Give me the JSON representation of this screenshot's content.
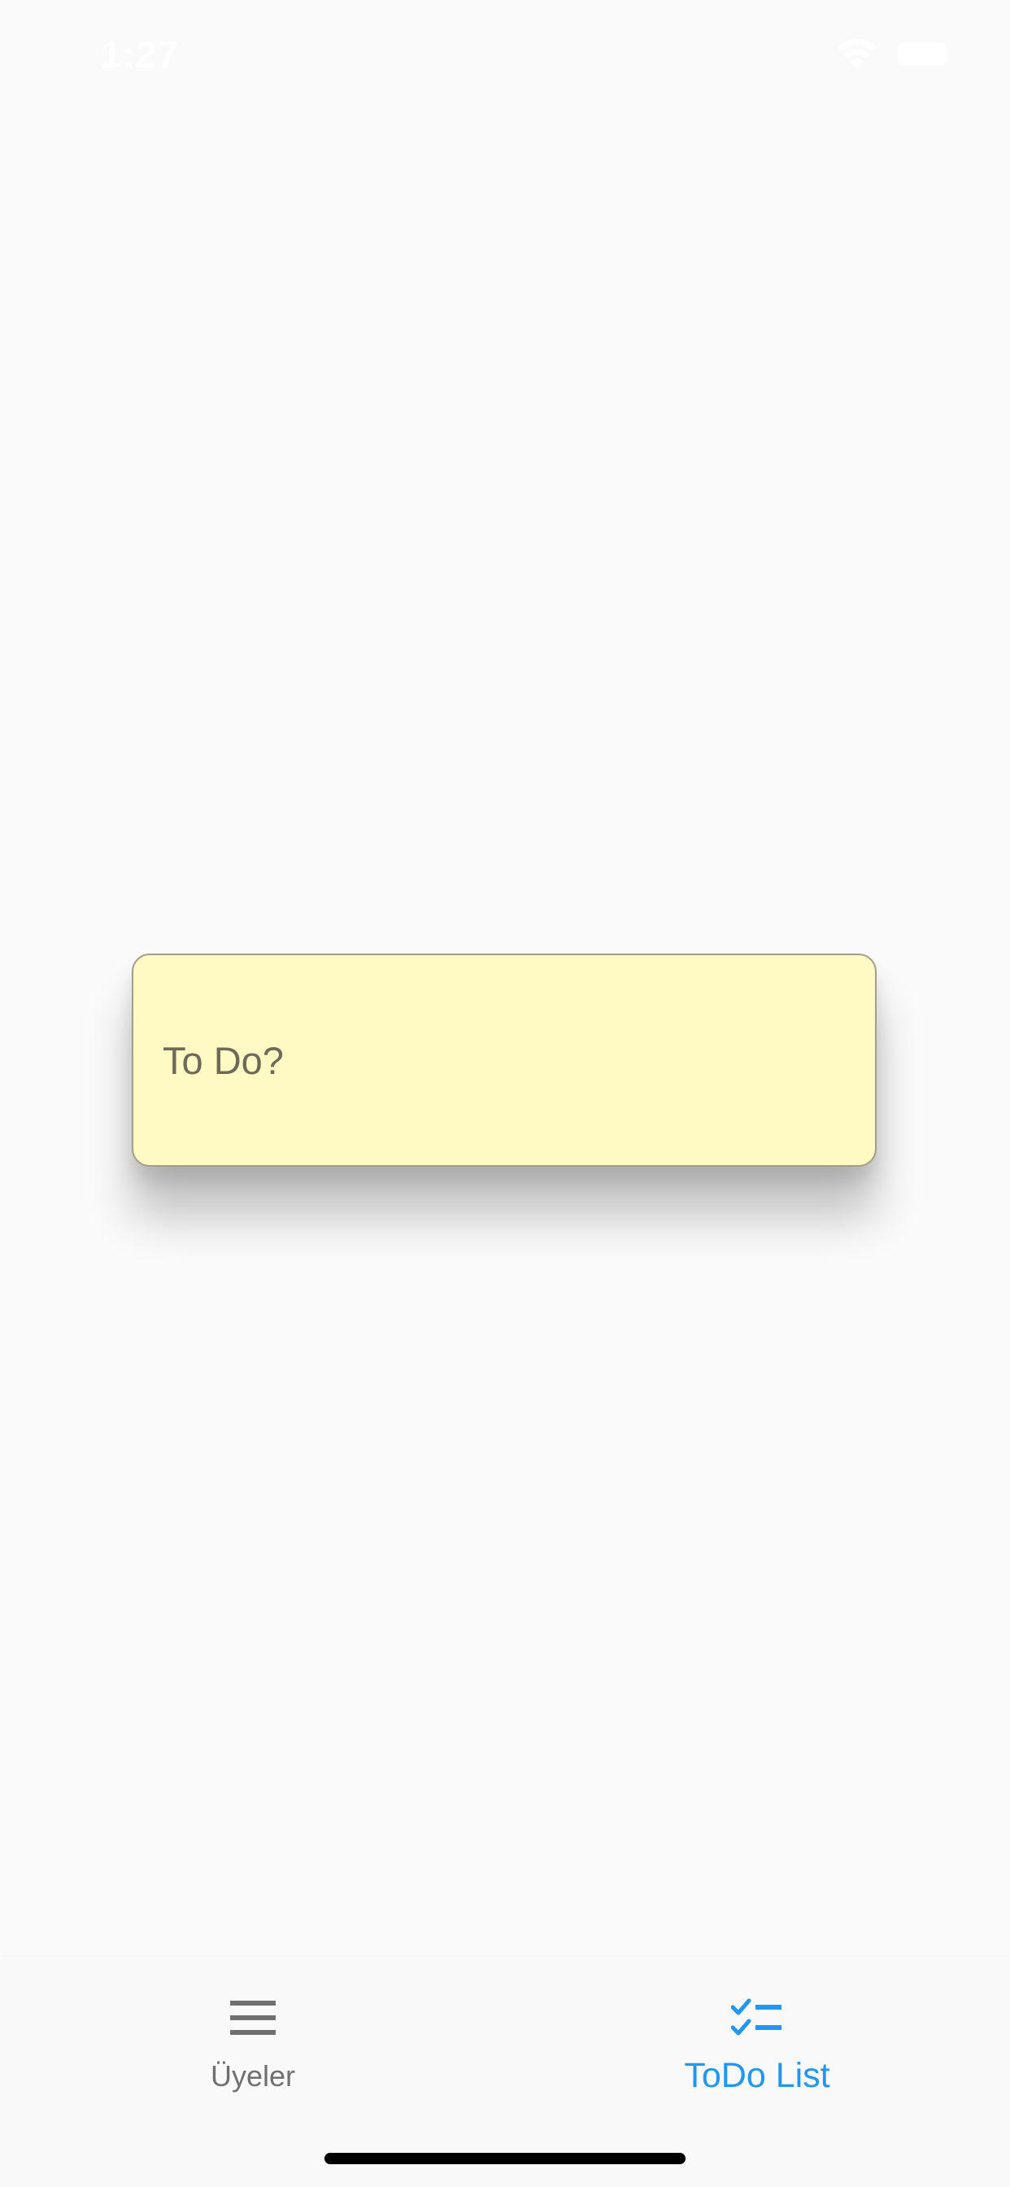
{
  "status_bar": {
    "time": "1:27",
    "icons": [
      "wifi-icon",
      "battery-icon"
    ]
  },
  "todo_card": {
    "placeholder": "To Do?",
    "value": "",
    "background_color": "#fff9c4"
  },
  "bottom_nav": {
    "items": [
      {
        "label": "Üyeler",
        "icon": "menu-icon",
        "active": false,
        "color": "#707070"
      },
      {
        "label": "ToDo List",
        "icon": "checklist-icon",
        "active": true,
        "color": "#2196f3"
      }
    ]
  }
}
